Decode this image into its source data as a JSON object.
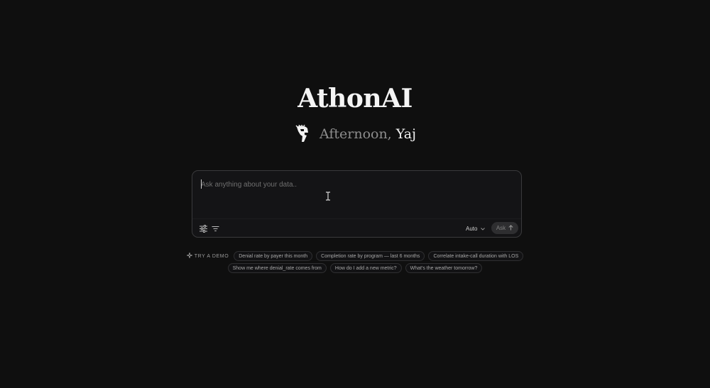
{
  "app": {
    "title": "AthonAI"
  },
  "greeting": {
    "prefix": "Afternoon,",
    "name": "Yaj"
  },
  "composer": {
    "placeholder": "Ask anything about your data..",
    "value": "",
    "mode": "Auto",
    "ask_label": "Ask"
  },
  "demo": {
    "label": "TRY A DEMO",
    "row1": [
      "Denial rate by payer this month",
      "Completion rate by program — last 6 months",
      "Correlate intake-call duration with LOS"
    ],
    "row2": [
      "Show me where denial_rate comes from",
      "How do I add a new metric?",
      "What's the weather tomorrow?"
    ]
  },
  "icons": {
    "logo": "spartan-helmet-icon",
    "tool1": "sliders-icon",
    "tool2": "filter-icon",
    "mode_chevron": "chevron-down-icon",
    "ask_arrow": "arrow-up-icon",
    "demo": "sparkle-icon"
  },
  "colors": {
    "background": "#0f0f0f",
    "composer_bg": "#141416",
    "border": "#3a3a3c"
  }
}
